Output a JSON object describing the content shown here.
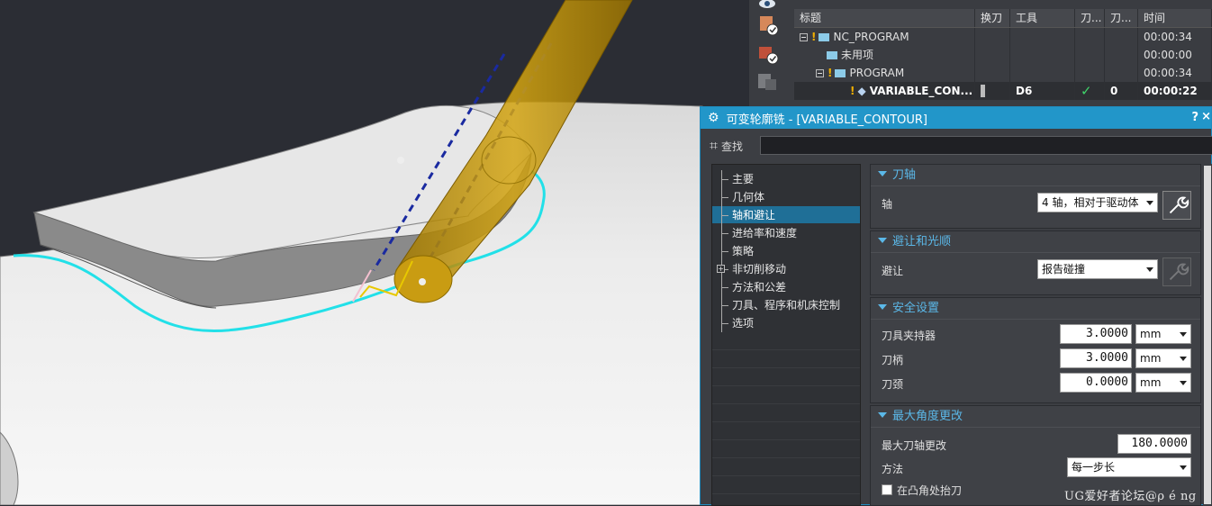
{
  "navigator": {
    "columns": [
      "标题",
      "换刀",
      "工具",
      "刀...",
      "刀...",
      "时间"
    ],
    "rows": [
      {
        "title": "NC_PROGRAM",
        "tool_change": "",
        "tool": "",
        "p1": "",
        "p2": "",
        "time": "00:00:34",
        "warn": "!"
      },
      {
        "title": "未用项",
        "tool_change": "",
        "tool": "",
        "p1": "",
        "p2": "",
        "time": "00:00:00",
        "warn": ""
      },
      {
        "title": "PROGRAM",
        "tool_change": "",
        "tool": "",
        "p1": "",
        "p2": "",
        "time": "00:00:34",
        "warn": "!"
      },
      {
        "title": "VARIABLE_CON...",
        "tool_change": "",
        "tool": "D6",
        "p1": "✓",
        "p2": "0",
        "time": "00:00:22",
        "warn": "!"
      }
    ]
  },
  "dialog": {
    "title": "可变轮廓铣 - [VARIABLE_CONTOUR]",
    "help": "?",
    "close": "×",
    "search_label": "查找",
    "search_value": "",
    "nav_items": [
      {
        "label": "主要"
      },
      {
        "label": "几何体"
      },
      {
        "label": "轴和避让",
        "active": true
      },
      {
        "label": "进给率和速度"
      },
      {
        "label": "策略"
      },
      {
        "label": "非切削移动",
        "expandable": true
      },
      {
        "label": "方法和公差"
      },
      {
        "label": "刀具、程序和机床控制"
      },
      {
        "label": "选项"
      }
    ],
    "groups": {
      "tool_axis": {
        "title": "刀轴",
        "axis_label": "轴",
        "axis_value": "4 轴，相对于驱动体"
      },
      "avoidance": {
        "title": "避让和光顺",
        "avoid_label": "避让",
        "avoid_value": "报告碰撞"
      },
      "safety": {
        "title": "安全设置",
        "holder_label": "刀具夹持器",
        "holder_value": "3.0000",
        "holder_unit": "mm",
        "shank_label": "刀柄",
        "shank_value": "3.0000",
        "shank_unit": "mm",
        "neck_label": "刀颈",
        "neck_value": "0.0000",
        "neck_unit": "mm"
      },
      "max_angle": {
        "title": "最大角度更改",
        "max_label": "最大刀轴更改",
        "max_value": "180.0000",
        "method_label": "方法",
        "method_value": "每一步长",
        "corner_label": "在凸角处抬刀"
      }
    }
  },
  "watermark": "UG爱好者论坛@ρ é ng",
  "colors": {
    "accent": "#2296c9",
    "toolpath": "#22e0e8",
    "tool": "#c89a10",
    "axis_line": "#1a2aa0"
  }
}
